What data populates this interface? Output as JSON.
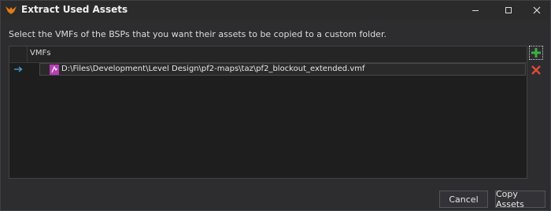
{
  "window": {
    "title": "Extract Used Assets",
    "controls": {
      "minimize": "minimize-icon",
      "maximize": "maximize-icon",
      "close": "close-icon"
    }
  },
  "instruction": "Select the VMFs of the BSPs that you want their assets to be copied to a custom folder.",
  "grid": {
    "column_header": "VMFs",
    "rows": [
      {
        "icon": "vmf-file-icon",
        "value": "D:\\Files\\Development\\Level Design\\pf2-maps\\taz\\pf2_blockout_extended.vmf",
        "current": true
      }
    ]
  },
  "side_buttons": {
    "add_icon": "plus-icon",
    "remove_icon": "remove-x-icon"
  },
  "footer": {
    "cancel_label": "Cancel",
    "copy_label": "Copy Assets"
  },
  "colors": {
    "accent_add": "#3cb043",
    "accent_remove": "#e04a3a",
    "file_icon": "#b83db8",
    "row_arrow": "#4a9bd6",
    "app_icon": "#e07b16"
  }
}
